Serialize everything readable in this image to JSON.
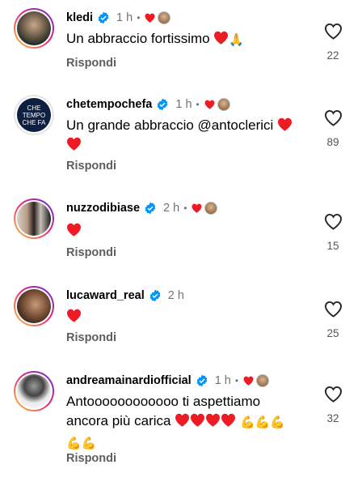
{
  "comments": [
    {
      "username": "kledi",
      "time": "1 h",
      "text": "Un abbraccio fortissimo",
      "emoji": "❤️🙏🏼",
      "reply": "Rispondi",
      "likes": "22",
      "avatar_bg": "#2b3a2f",
      "liked_by_author": true
    },
    {
      "username": "chetempochefa",
      "time": "1 h",
      "text": "Un grande abbraccio @antoclerici",
      "emoji": "❤️",
      "line2": "❤️",
      "reply": "Rispondi",
      "likes": "89",
      "avatar_bg": "#0f1f3f",
      "avatar_text": "CHE TEMPO CHE FA",
      "liked_by_author": true
    },
    {
      "username": "nuzzodibiase",
      "time": "2 h",
      "text": "",
      "emoji": "❤️",
      "reply": "Rispondi",
      "likes": "15",
      "avatar_bg": "#cfc7c0",
      "liked_by_author": true
    },
    {
      "username": "lucaward_real",
      "time": "2 h",
      "text": "",
      "emoji": "❤️",
      "reply": "Rispondi",
      "likes": "25",
      "avatar_bg": "#3b2a20",
      "liked_by_author": false
    },
    {
      "username": "andreamainardiofficial",
      "time": "1 h",
      "text": "Antoooooooooooo ti aspettiamo",
      "line2": "ancora più carica",
      "emoji": "❤️❤️❤️❤️💪🏻💪🏻💪🏻",
      "line3": "💪🏻💪🏻",
      "reply": "Rispondi",
      "likes": "32",
      "avatar_bg": "#e8e8e8",
      "liked_by_author": true
    }
  ],
  "colors": {
    "verified": "#0095f6",
    "heart": "#ed1c24",
    "muted": "#737373"
  }
}
